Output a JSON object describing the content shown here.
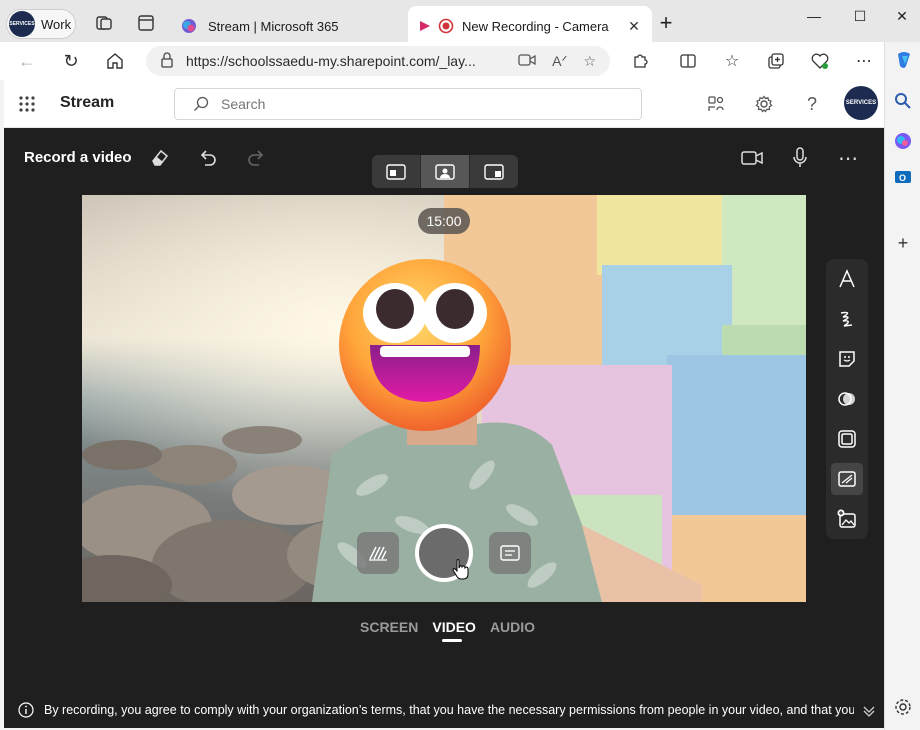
{
  "browser": {
    "profile_label": "Work",
    "profile_avatar_text": "SERVICES",
    "tabs": [
      {
        "title": "Stream | Microsoft 365"
      },
      {
        "title": "New Recording - Camera"
      }
    ],
    "new_tab_label": "+",
    "url": "https://schoolssaedu-my.sharepoint.com/_lay..."
  },
  "stream": {
    "app_name": "Stream",
    "search_placeholder": "Search",
    "user_avatar_text": "SERVICES"
  },
  "recorder": {
    "title": "Record a video",
    "timer": "15:00",
    "modes": [
      {
        "label": "SCREEN"
      },
      {
        "label": "VIDEO"
      },
      {
        "label": "AUDIO"
      }
    ],
    "active_mode": "VIDEO",
    "disclaimer": "By recording, you agree to comply with your organization’s terms, that you have the necessary permissions from people in your video, and that you w..."
  },
  "icons": {
    "recorder_tools": [
      "eraser-icon",
      "undo-icon",
      "redo-icon"
    ],
    "recorder_right": [
      "camera-icon",
      "microphone-icon",
      "more-icon"
    ],
    "layouts": [
      "screen-only-layout-icon",
      "camera-only-layout-icon",
      "screen-and-camera-layout-icon"
    ],
    "effects": [
      "text-icon",
      "pen-icon",
      "sticker-icon",
      "filter-icon",
      "frame-icon",
      "background-blur-icon",
      "background-image-icon"
    ]
  },
  "colors": {
    "recorder_bg": "#1f1f1f",
    "accent": "#ffffff",
    "brand_avatar": "#1c2b4f"
  }
}
